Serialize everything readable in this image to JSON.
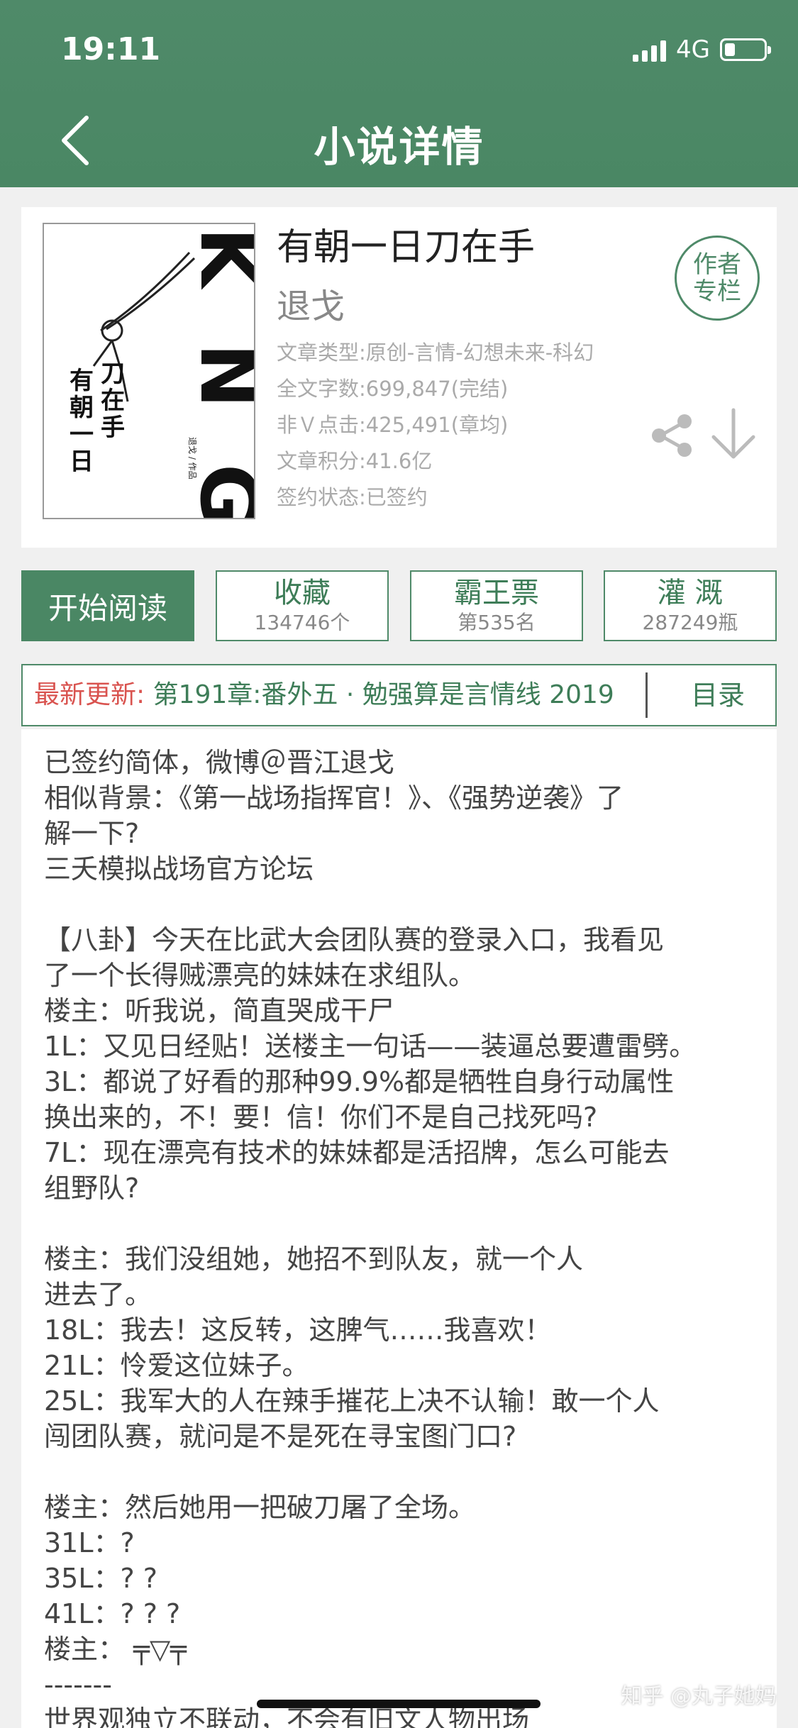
{
  "status_bar": {
    "time": "19:11",
    "network": "4G"
  },
  "header": {
    "title": "小说详情"
  },
  "book": {
    "cover": {
      "title_chars": [
        "有",
        "朝",
        "一",
        "日",
        "刀",
        "在",
        "手"
      ],
      "brand_text": "K N G",
      "credit": "退戈 / 作品"
    },
    "title": "有朝一日刀在手",
    "author": "退戈",
    "meta": [
      "文章类型:原创-言情-幻想未来-科幻",
      "全文字数:699,847(完结)",
      "非Ｖ点击:425,491(章均)",
      "文章积分:41.6亿",
      "签约状态:已签约"
    ],
    "author_column": [
      "作者",
      "专栏"
    ]
  },
  "actions": {
    "start_reading": "开始阅读",
    "collect": {
      "label": "收藏",
      "value": "134746个"
    },
    "ticket": {
      "label": "霸王票",
      "value": "第535名"
    },
    "water": {
      "label": "灌 溉",
      "value": "287249瓶"
    }
  },
  "update": {
    "label": "最新更新: ",
    "chapter": "第191章:番外五 · 勉强算是言情线 2019",
    "toc": "目录"
  },
  "intro": [
    "已签约简体，微博＠晋江退戈",
    "相似背景：《第一战场指挥官！》、《强势逆袭》了",
    "解一下?",
    "三夭模拟战场官方论坛",
    "",
    "【八卦】今天在比武大会团队赛的登录入口，我看见",
    "了一个长得贼漂亮的妹妹在求组队。",
    "楼主：听我说，简直哭成干尸",
    "1L：又见日经贴！送楼主一句话——装逼总要遭雷劈。",
    "3L：都说了好看的那种99.9%都是牺牲自身行动属性",
    "换出来的，不！要！信！你们不是自己找死吗?",
    "7L：现在漂亮有技术的妹妹都是活招牌，怎么可能去",
    "组野队?",
    "",
    "楼主：我们没组她，她招不到队友，就一个人",
    "进去了。",
    "18L：我去！这反转，这脾气……我喜欢！",
    "21L：怜爱这位妹子。",
    "25L：我军大的人在辣手摧花上决不认输！敢一个人",
    "闯团队赛，就问是不是死在寻宝图门口?",
    "",
    "楼主：然后她用一把破刀屠了全场。",
    "31L：?",
    "35L：? ?",
    "41L：? ? ?",
    "楼主： ╤▽╤",
    "-------",
    "世界观独立不联动，不会有旧文人物出场"
  ],
  "watermark": "知乎 @丸子她妈",
  "colors": {
    "brand_green": "#4a8764",
    "update_red": "#d9534f"
  }
}
